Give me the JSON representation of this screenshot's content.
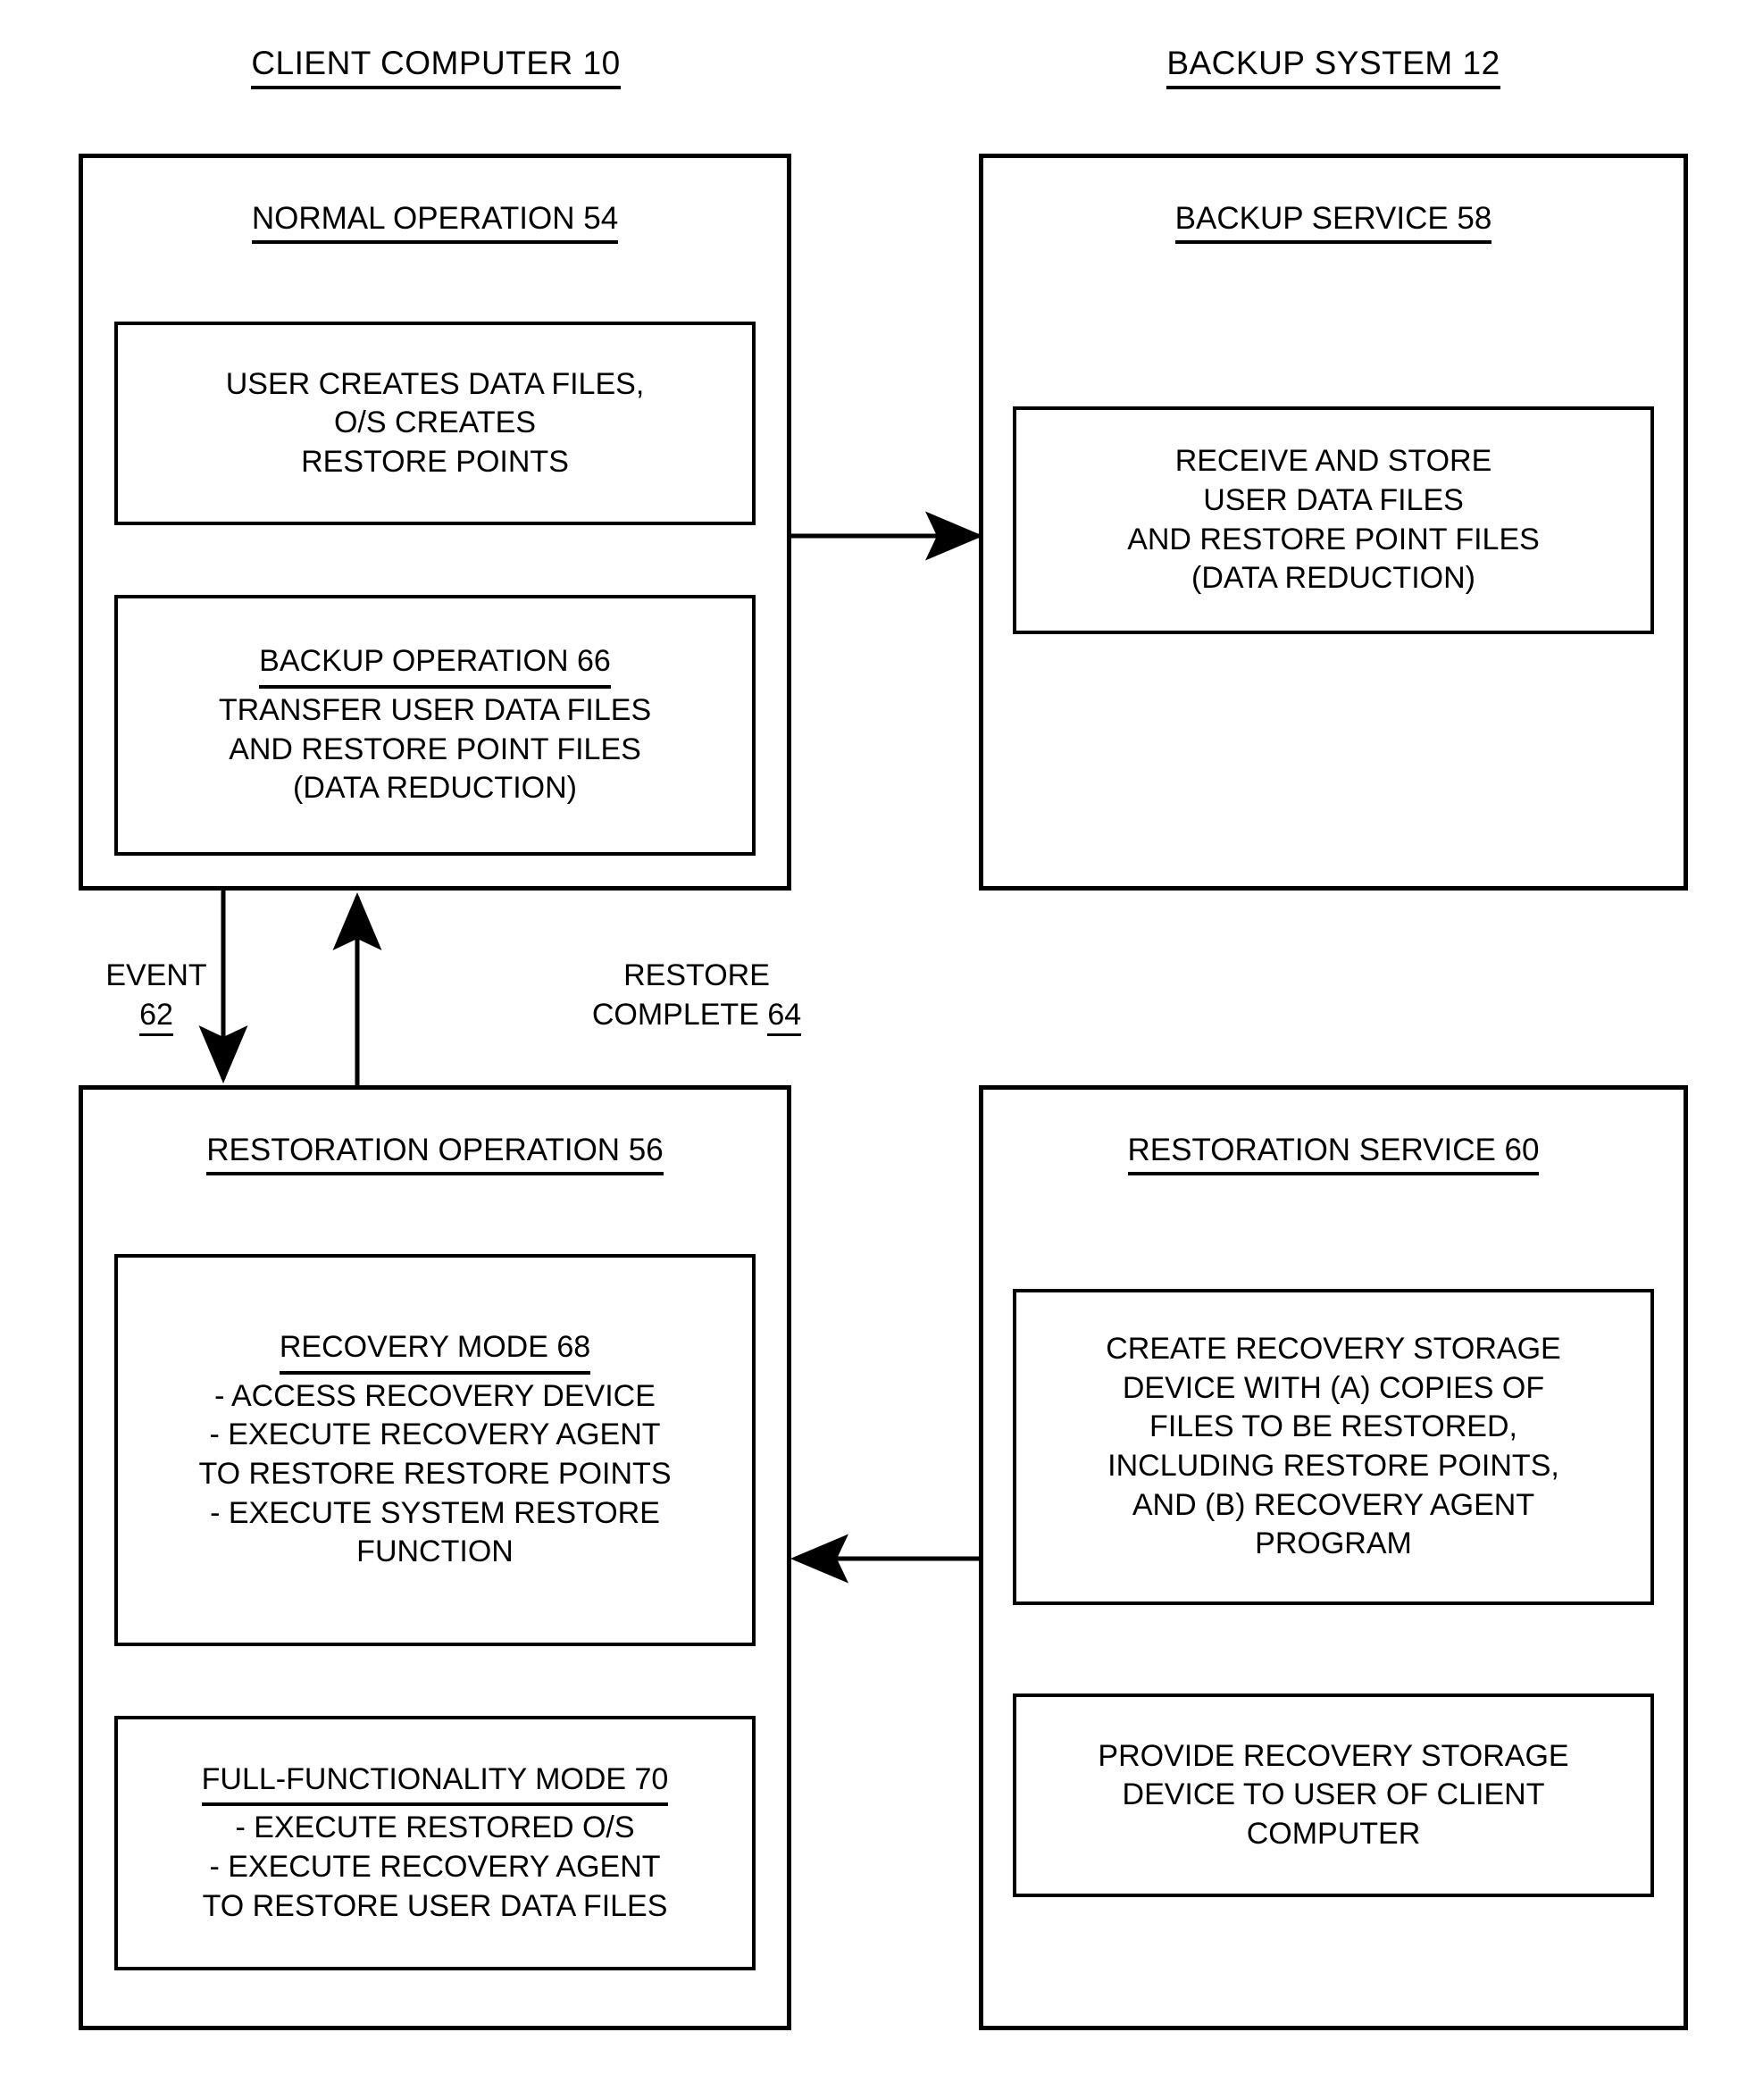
{
  "columns": {
    "left_heading": "CLIENT COMPUTER 10",
    "right_heading": "BACKUP SYSTEM 12"
  },
  "groups": {
    "normal_operation": {
      "title": "NORMAL OPERATION 54",
      "steps": {
        "user_creates": {
          "lines": [
            "USER CREATES DATA FILES,",
            "O/S CREATES",
            "RESTORE POINTS"
          ]
        },
        "backup_operation": {
          "header": "BACKUP OPERATION 66",
          "lines": [
            "TRANSFER USER DATA FILES",
            "AND RESTORE POINT FILES",
            "(DATA REDUCTION)"
          ]
        }
      }
    },
    "backup_service": {
      "title": "BACKUP SERVICE 58",
      "steps": {
        "receive_and_store": {
          "lines": [
            "RECEIVE AND STORE",
            "USER DATA FILES",
            "AND RESTORE POINT FILES",
            "(DATA REDUCTION)"
          ]
        }
      }
    },
    "restoration_operation": {
      "title": "RESTORATION OPERATION 56",
      "steps": {
        "recovery_mode": {
          "header": "RECOVERY MODE 68",
          "lines": [
            "- ACCESS RECOVERY DEVICE",
            "- EXECUTE RECOVERY AGENT",
            "TO RESTORE RESTORE POINTS",
            "- EXECUTE SYSTEM RESTORE",
            "FUNCTION"
          ]
        },
        "full_functionality_mode": {
          "header": "FULL-FUNCTIONALITY MODE 70",
          "lines": [
            "- EXECUTE RESTORED O/S",
            "- EXECUTE RECOVERY AGENT",
            "TO RESTORE USER DATA FILES"
          ]
        }
      }
    },
    "restoration_service": {
      "title": "RESTORATION SERVICE 60",
      "steps": {
        "create_recovery_device": {
          "lines": [
            "CREATE RECOVERY STORAGE",
            "DEVICE WITH (A) COPIES OF",
            "FILES TO BE RESTORED,",
            "INCLUDING RESTORE POINTS,",
            "AND (B) RECOVERY AGENT",
            "PROGRAM"
          ]
        },
        "provide_recovery_device": {
          "lines": [
            "PROVIDE RECOVERY STORAGE",
            "DEVICE TO USER OF CLIENT",
            "COMPUTER"
          ]
        }
      }
    }
  },
  "flows": {
    "event": {
      "line1": "EVENT",
      "line2": "62"
    },
    "restore_complete": {
      "line1": "RESTORE",
      "line2": "COMPLETE ",
      "line2_ref": "64"
    }
  },
  "style": {
    "line_color": "#000000",
    "background": "#ffffff"
  }
}
